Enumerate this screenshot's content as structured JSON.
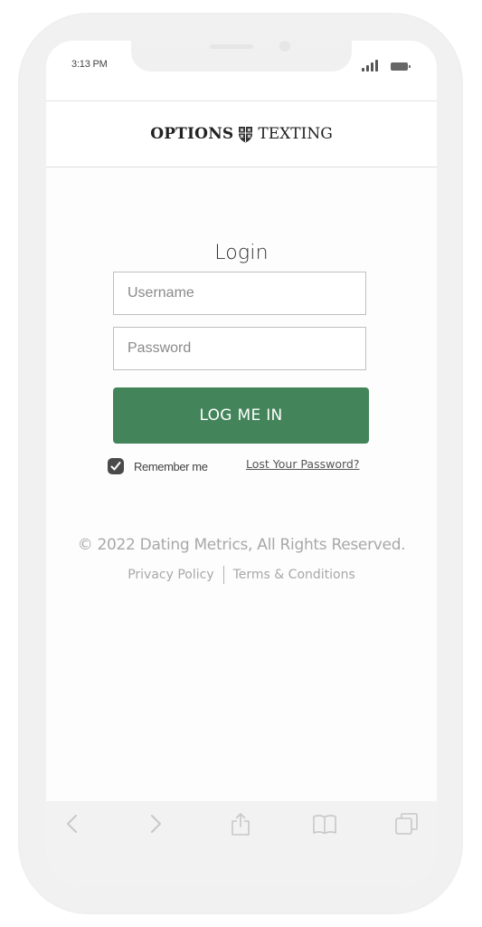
{
  "status_bar": {
    "time": "3:13 PM"
  },
  "brand": {
    "left": "OPTIONS",
    "right": "TEXTING"
  },
  "login": {
    "title": "Login",
    "username_placeholder": "Username",
    "password_placeholder": "Password",
    "button_label": "LOG ME IN",
    "remember_label": "Remember me",
    "remember_checked": true,
    "lost_password_label": "Lost Your Password?"
  },
  "footer": {
    "copyright": "© 2022 Dating Metrics, All Rights Reserved.",
    "privacy_label": "Privacy Policy",
    "terms_label": "Terms & Conditions"
  },
  "toolbar": {
    "icons": [
      "back-icon",
      "forward-icon",
      "share-icon",
      "bookmarks-icon",
      "tabs-icon"
    ]
  },
  "colors": {
    "accent": "#43845a",
    "muted_text": "#a8a8a8",
    "frame": "#efefef"
  }
}
